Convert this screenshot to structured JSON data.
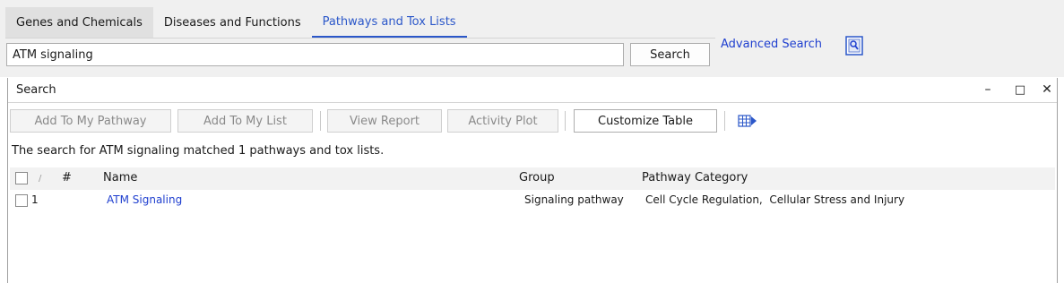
{
  "tabs": [
    {
      "label": "Genes and Chemicals"
    },
    {
      "label": "Diseases and Functions"
    },
    {
      "label": "Pathways and Tox Lists"
    }
  ],
  "search": {
    "value": "ATM signaling",
    "button_label": "Search",
    "advanced_label": "Advanced Search"
  },
  "panel": {
    "title": "Search",
    "controls": {
      "minimize": "–",
      "maximize": "□",
      "close": "✕"
    }
  },
  "toolbar": {
    "add_pathway": "Add To My Pathway",
    "add_list": "Add To My List",
    "view_report": "View Report",
    "activity_plot": "Activity Plot",
    "customize_table": "Customize Table"
  },
  "summary": "The search for ATM signaling matched 1 pathways and tox lists.",
  "table": {
    "columns": {
      "sort": "/",
      "num": "#",
      "name": "Name",
      "group": "Group",
      "category": "Pathway Category"
    },
    "rows": [
      {
        "num": "1",
        "name": "ATM Signaling",
        "group": "Signaling pathway",
        "category": "Cell Cycle Regulation,  Cellular Stress and Injury"
      }
    ]
  },
  "colors": {
    "accent": "#2b57c9",
    "link": "#1f3fcf"
  },
  "icons": {
    "advanced": "advanced-search-icon",
    "columns": "table-columns-icon"
  }
}
